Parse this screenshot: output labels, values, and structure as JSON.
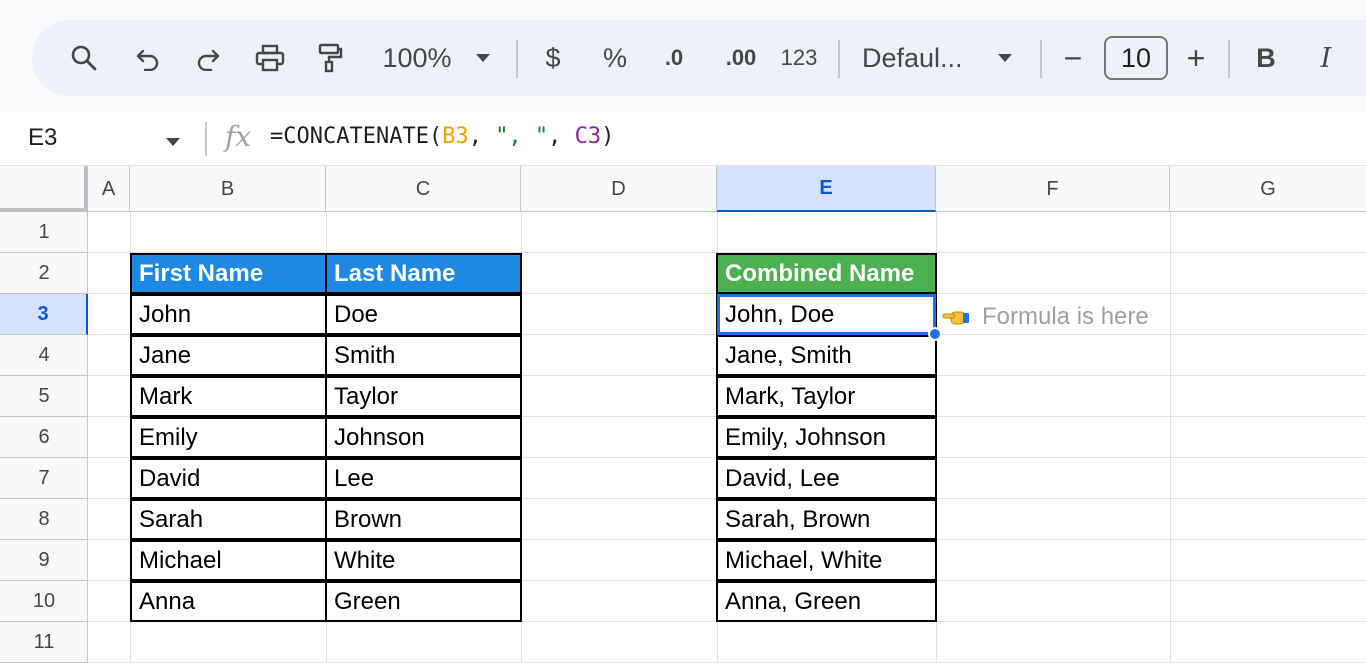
{
  "toolbar": {
    "zoom": "100%",
    "currency": "$",
    "percent": "%",
    "decrease_decimal": ".0",
    "increase_decimal": ".00",
    "number_format": "123",
    "font": "Defaul...",
    "font_size": "10",
    "minus": "−",
    "plus": "+",
    "bold": "B",
    "italic": "I"
  },
  "formula_bar": {
    "cell_ref": "E3",
    "fx": "fx",
    "formula_prefix": "=CONCATENATE(",
    "arg1": "B3",
    "sep1": ", ",
    "arg2": "\", \"",
    "sep2": ", ",
    "arg3": "C3",
    "formula_suffix": ")"
  },
  "columns": [
    "A",
    "B",
    "C",
    "D",
    "E",
    "F",
    "G"
  ],
  "rows": [
    "1",
    "2",
    "3",
    "4",
    "5",
    "6",
    "7",
    "8",
    "9",
    "10",
    "11"
  ],
  "selected_cell": "E3",
  "table1": {
    "headers": [
      "First Name",
      "Last Name"
    ],
    "rows": [
      [
        "John",
        "Doe"
      ],
      [
        "Jane",
        "Smith"
      ],
      [
        "Mark",
        "Taylor"
      ],
      [
        "Emily",
        "Johnson"
      ],
      [
        "David",
        "Lee"
      ],
      [
        "Sarah",
        "Brown"
      ],
      [
        "Michael",
        "White"
      ],
      [
        "Anna",
        "Green"
      ]
    ]
  },
  "table2": {
    "header": "Combined Name",
    "rows": [
      "John, Doe",
      "Jane, Smith",
      "Mark, Taylor",
      "Emily, Johnson",
      "David, Lee",
      "Sarah, Brown",
      "Michael, White",
      "Anna, Green"
    ]
  },
  "note": {
    "icon": "pointing-hand-icon",
    "text": "Formula is here"
  },
  "colors": {
    "header_blue": "#1e88e5",
    "header_green": "#4caf50",
    "selection": "#1a73e8"
  }
}
